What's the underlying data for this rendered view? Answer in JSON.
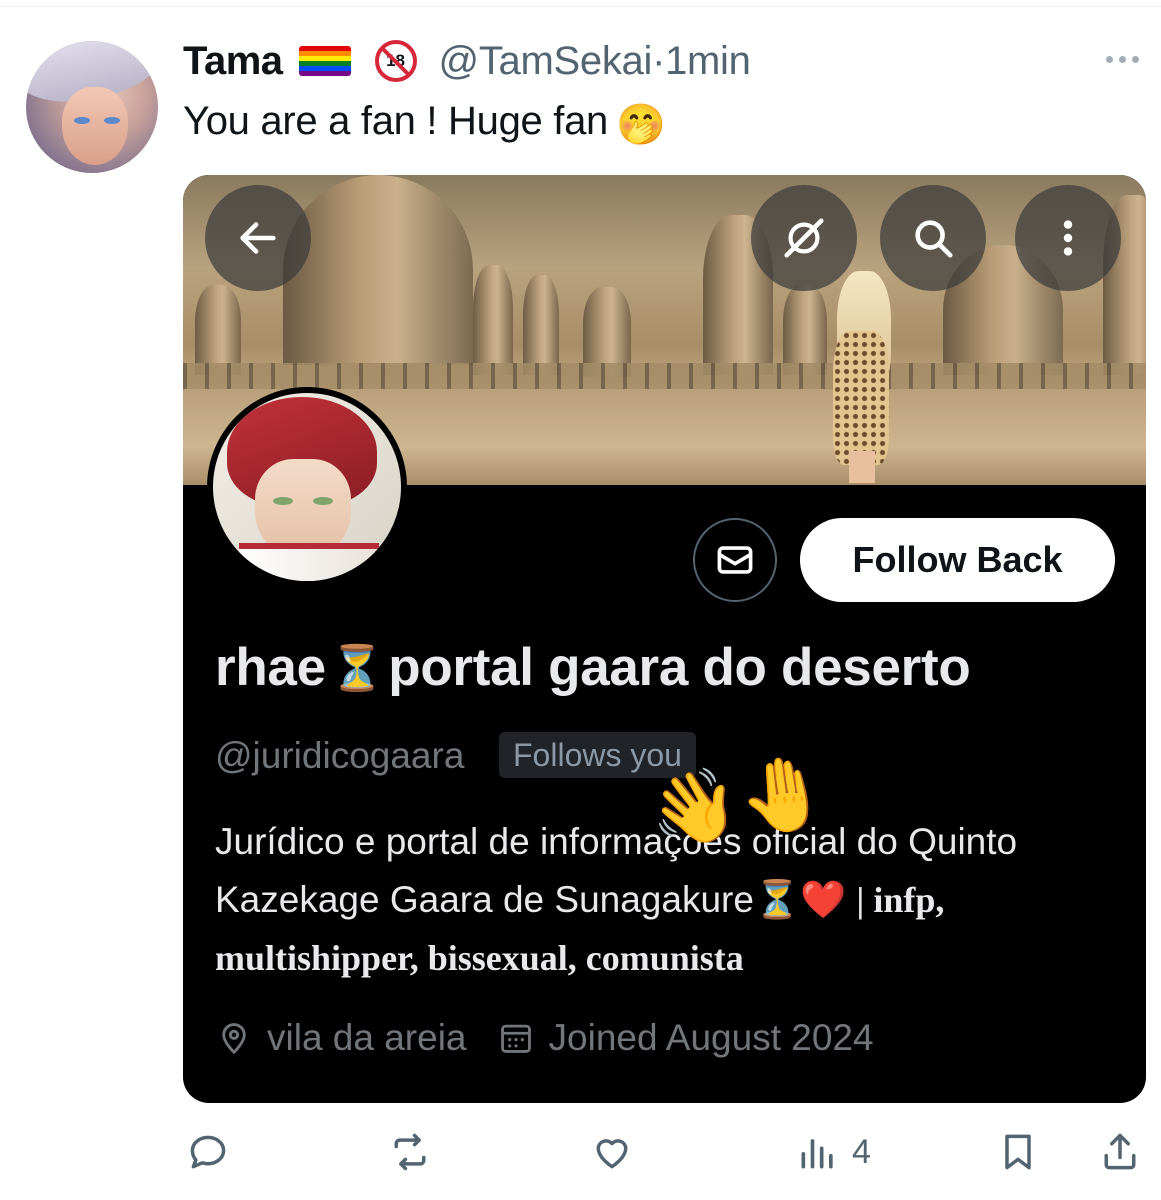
{
  "tweet": {
    "author_name": "Tama",
    "flag_emoji": "rainbow-flag",
    "age_badge": "18",
    "handle": "@TamSekai",
    "separator": "·",
    "time": "1min",
    "text": "You are a fan ! Huge fan",
    "text_emoji": "🤭"
  },
  "profile_card": {
    "display_name_part1": "rhae",
    "hourglass": "⏳",
    "display_name_part2": "portal gaara do deserto",
    "username": "@juridicogaara",
    "follows_you": "Follows you",
    "follow_button": "Follow Back",
    "bio_line1": "Jurídico e portal de informações oficial do Quinto",
    "bio_line2_a": "Kazekage Gaara de Sunagakure",
    "bio_line2_heart": "❤️",
    "bio_line2_b": "| infp,",
    "bio_line3": "multishipper, bissexual, comunista",
    "overlay_emoji": "👋🤚",
    "location": "vila da areia",
    "joined": "Joined August 2024"
  },
  "actions": {
    "views_count": "4"
  },
  "colors": {
    "text_primary": "#0f1419",
    "text_secondary": "#536471",
    "card_bg": "#000000",
    "card_text": "#e7e9ea",
    "card_muted": "#71767b"
  }
}
